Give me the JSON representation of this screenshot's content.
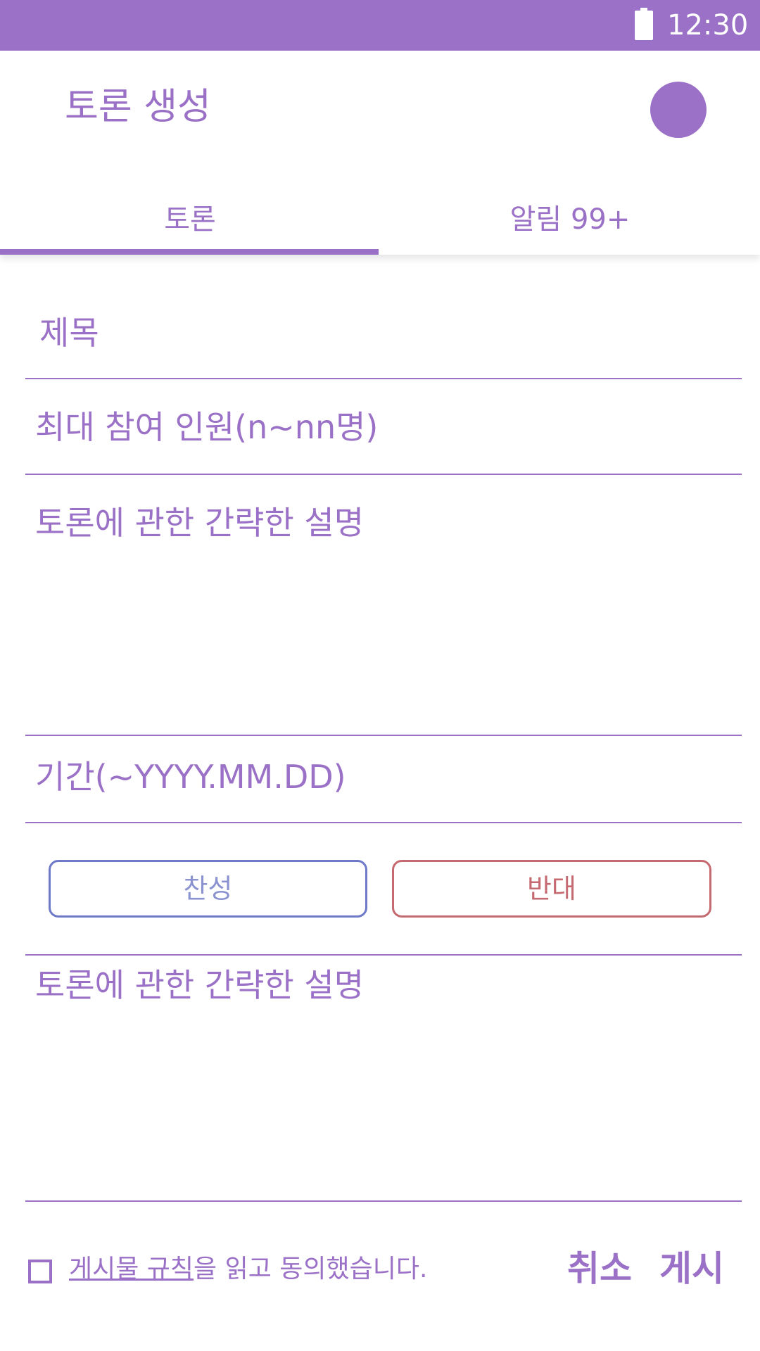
{
  "status_bar": {
    "time": "12:30"
  },
  "app_bar": {
    "title": "토론 생성"
  },
  "tabs": [
    {
      "label": "토론"
    },
    {
      "label": "알림 99+"
    }
  ],
  "form": {
    "title_placeholder": "제목",
    "max_participants_placeholder": "최대 참여 인원(n~nn명)",
    "description_placeholder": "토론에 관한 간략한 설명",
    "period_placeholder": "기간(~YYYY.MM.DD)",
    "agree_label": "찬성",
    "oppose_label": "반대",
    "opinion_placeholder": "토론에 관한 간략한 설명"
  },
  "footer": {
    "rules_link": "게시물 규칙",
    "rules_suffix": "을 읽고 동의했습니다.",
    "rules_checked": false,
    "cancel_label": "취소",
    "post_label": "게시"
  },
  "colors": {
    "accent": "#9A71C6",
    "agree": "#6E79C8",
    "oppose": "#C66A72"
  }
}
